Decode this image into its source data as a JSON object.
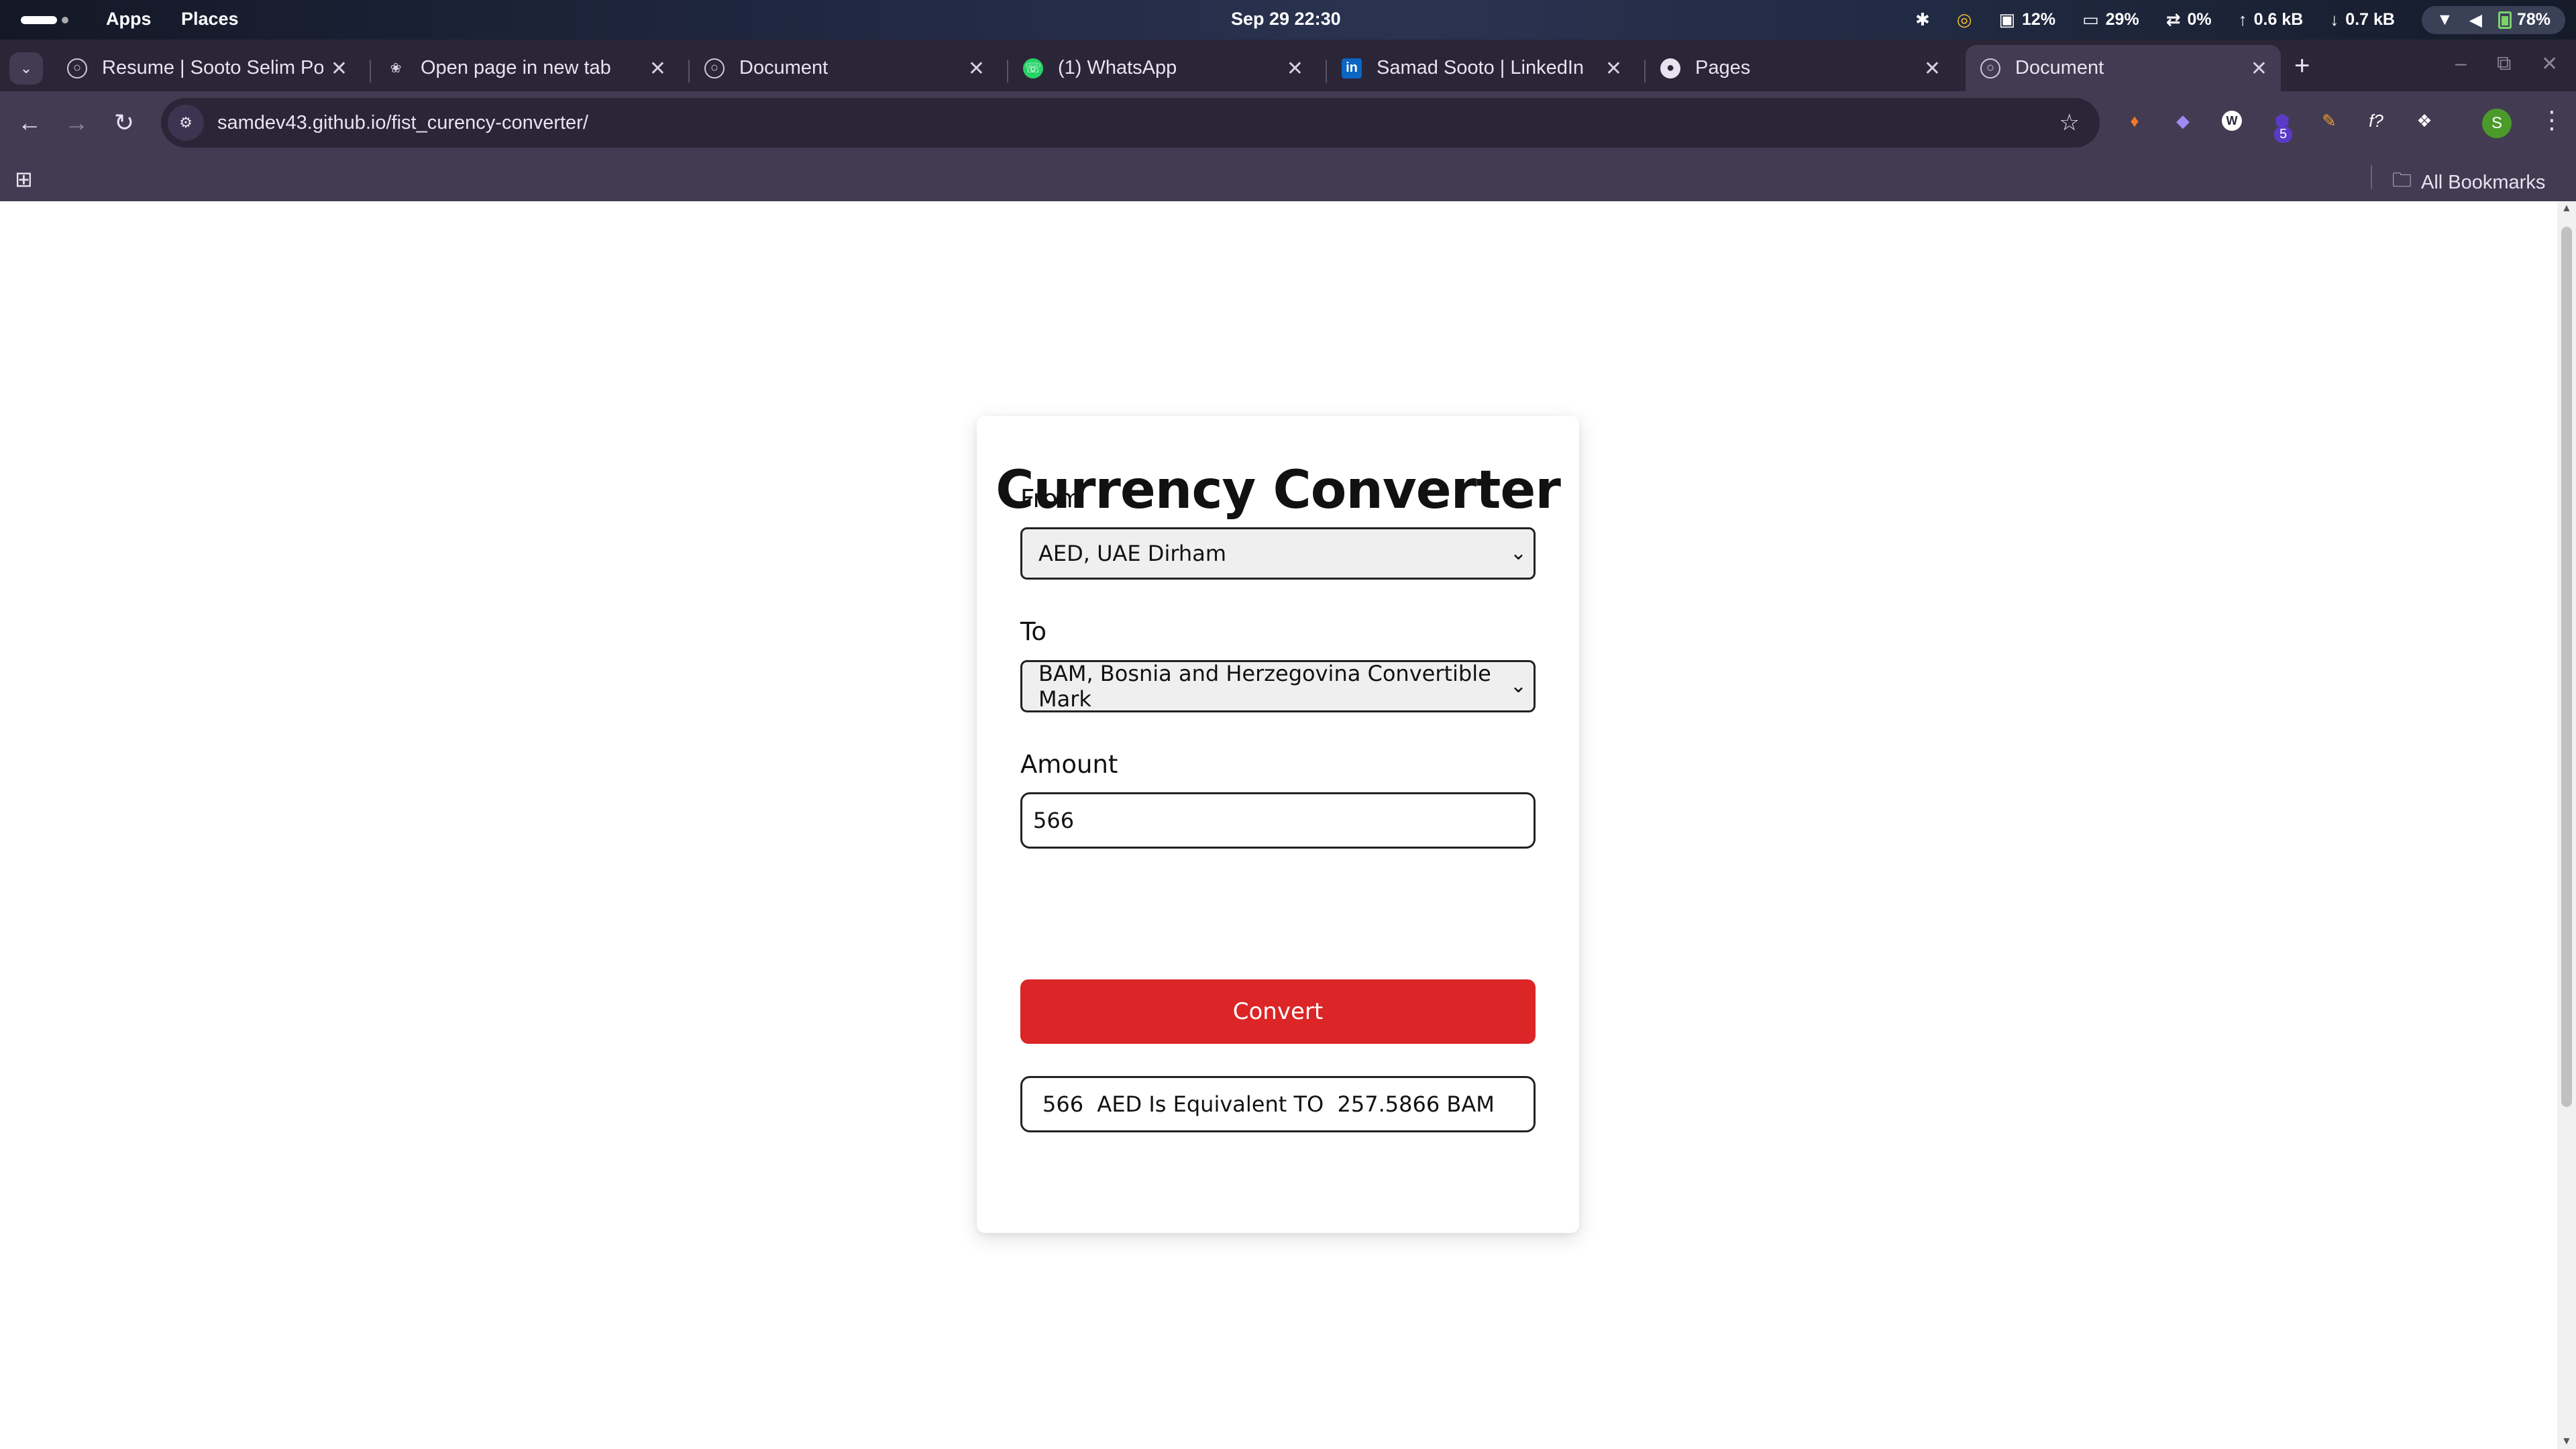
{
  "os": {
    "menu_apps": "Apps",
    "menu_places": "Places",
    "clock": "Sep 29  22:30",
    "cpu": "12%",
    "memory": "29%",
    "swap": "0%",
    "net_up": "0.6 kB",
    "net_down": "0.7 kB",
    "battery": "78%"
  },
  "browser": {
    "tabs": [
      {
        "title": "Resume | Sooto Selim Po",
        "icon": "globe-icon"
      },
      {
        "title": "Open page in new tab",
        "icon": "chatgpt-icon"
      },
      {
        "title": "Document",
        "icon": "globe-icon"
      },
      {
        "title": "(1) WhatsApp",
        "icon": "whatsapp-icon"
      },
      {
        "title": "Samad Sooto | LinkedIn",
        "icon": "linkedin-icon"
      },
      {
        "title": "Pages",
        "icon": "github-icon"
      },
      {
        "title": "Document",
        "icon": "globe-icon",
        "active": true
      }
    ],
    "url": "samdev43.github.io/fist_curency-converter/",
    "extension_badge": "5",
    "profile_initial": "S",
    "all_bookmarks": "All Bookmarks"
  },
  "app": {
    "title": "Currency Converter",
    "from_label": "From",
    "from_value": "AED, UAE Dirham",
    "to_label": "To",
    "to_value": "BAM, Bosnia and Herzegovina Convertible Mark",
    "amount_label": "Amount",
    "amount_value": "566",
    "convert_label": "Convert",
    "result": "566  AED Is Equivalent TO  257.5866 BAM"
  },
  "colors": {
    "convert_button": "#dc2526",
    "browser_frame": "#433b52",
    "tab_strip": "#2b2538"
  }
}
